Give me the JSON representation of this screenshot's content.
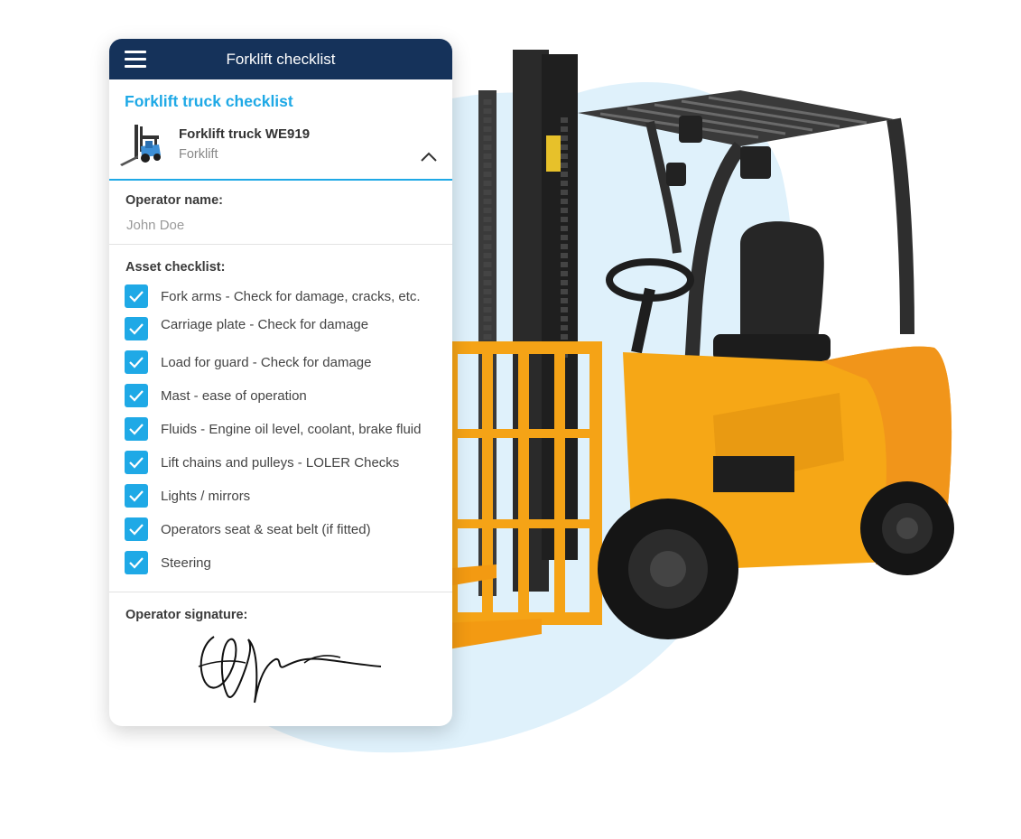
{
  "colors": {
    "header_bg": "#15325a",
    "accent": "#1fa9e6",
    "blob": "#dff1fb",
    "forklift_body": "#f6a716"
  },
  "header": {
    "title": "Forklift checklist",
    "menu_icon": "hamburger-menu-icon"
  },
  "asset": {
    "checklist_title": "Forklift truck checklist",
    "name": "Forklift truck WE919",
    "type": "Forklift",
    "thumbnail_icon": "forklift-thumbnail-icon",
    "toggle_icon": "chevron-up-icon"
  },
  "operator": {
    "label": "Operator name:",
    "value": "John Doe"
  },
  "checklist": {
    "label": "Asset checklist:",
    "items": [
      {
        "label": "Fork arms - Check for damage, cracks, etc.",
        "checked": true
      },
      {
        "label": "Carriage plate - Check for damage",
        "checked": true
      },
      {
        "label": "Load for guard - Check for damage",
        "checked": true
      },
      {
        "label": "Mast - ease of operation",
        "checked": true
      },
      {
        "label": "Fluids - Engine oil level, coolant, brake fluid",
        "checked": true
      },
      {
        "label": "Lift chains and pulleys - LOLER Checks",
        "checked": true
      },
      {
        "label": "Lights / mirrors",
        "checked": true
      },
      {
        "label": "Operators seat & seat belt (if fitted)",
        "checked": true
      },
      {
        "label": "Steering",
        "checked": true
      }
    ]
  },
  "signature": {
    "label": "Operator signature:"
  }
}
